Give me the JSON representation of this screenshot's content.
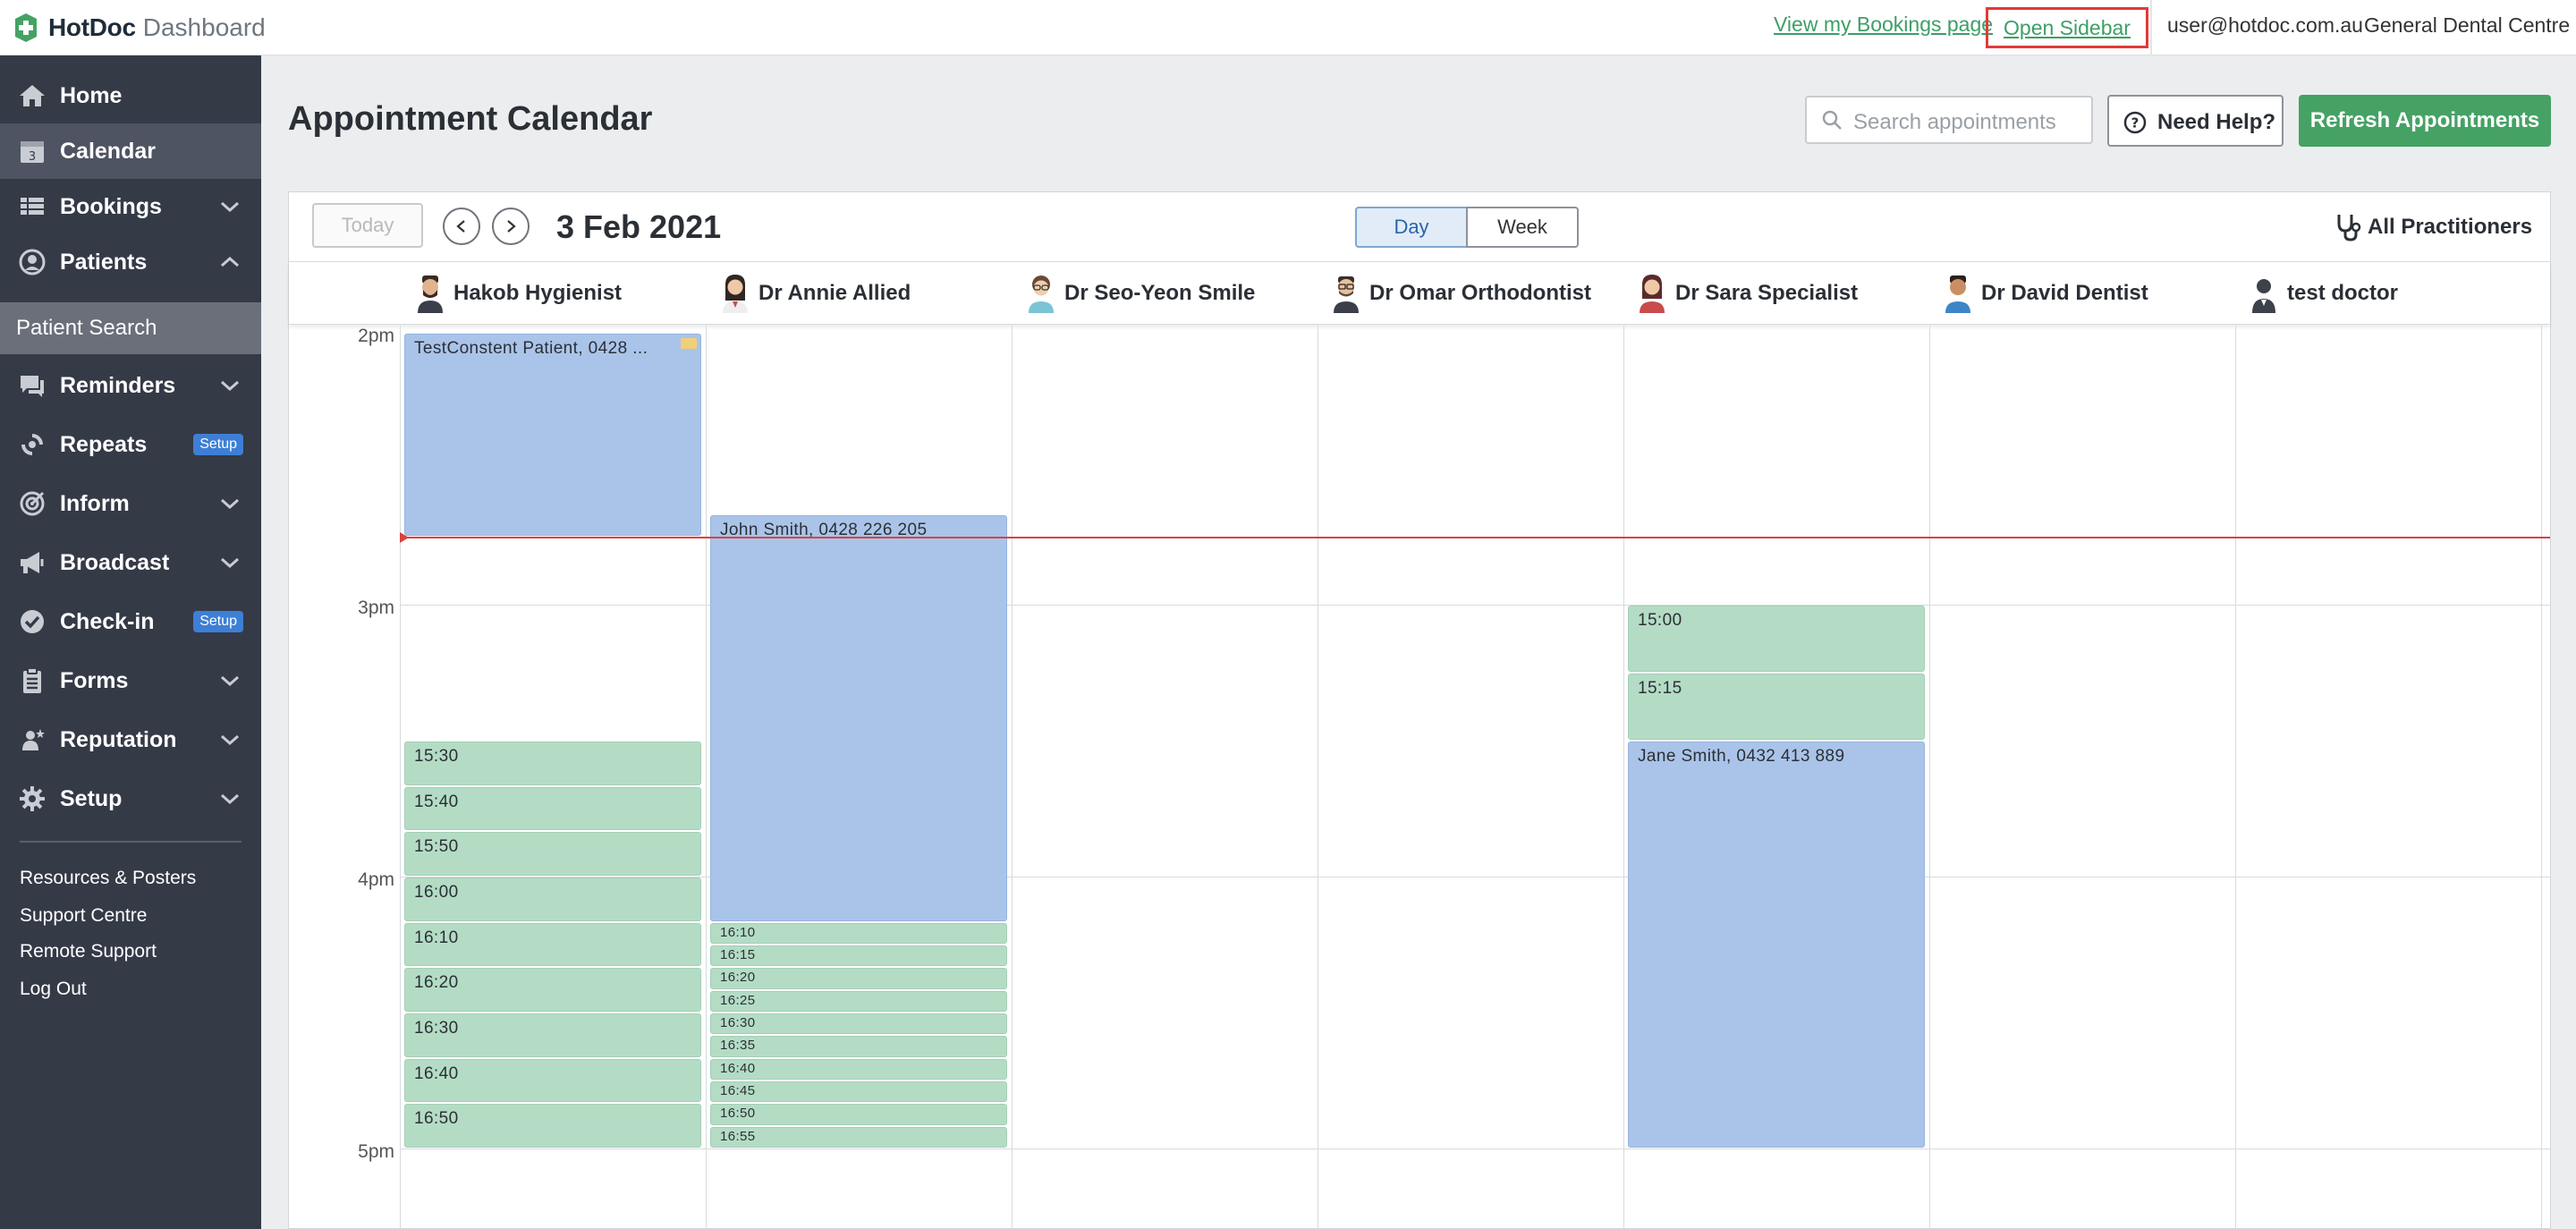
{
  "topbar": {
    "brand": "HotDoc",
    "brand_sub": "Dashboard",
    "bookings_link": "View my Bookings page",
    "open_sidebar": "Open Sidebar",
    "user_email": "user@hotdoc.com.au",
    "clinic_name": "General Dental Centre"
  },
  "sidebar": {
    "items": [
      {
        "label": "Home",
        "icon": "home-icon"
      },
      {
        "label": "Calendar",
        "icon": "calendar-icon",
        "active": true
      },
      {
        "label": "Bookings",
        "icon": "grid-icon",
        "chevron": "down"
      },
      {
        "label": "Patients",
        "icon": "user-circle-icon",
        "chevron": "up"
      },
      {
        "label": "Reminders",
        "icon": "chat-icon",
        "chevron": "down"
      },
      {
        "label": "Repeats",
        "icon": "refresh-icon",
        "badge": "Setup"
      },
      {
        "label": "Inform",
        "icon": "target-icon",
        "chevron": "down"
      },
      {
        "label": "Broadcast",
        "icon": "megaphone-icon",
        "chevron": "down"
      },
      {
        "label": "Check-in",
        "icon": "check-circle-icon",
        "badge": "Setup"
      },
      {
        "label": "Forms",
        "icon": "clipboard-icon",
        "chevron": "down"
      },
      {
        "label": "Reputation",
        "icon": "person-star-icon",
        "chevron": "down"
      },
      {
        "label": "Setup",
        "icon": "gear-icon",
        "chevron": "down"
      }
    ],
    "subitem": "Patient Search",
    "links": [
      "Resources & Posters",
      "Support Centre",
      "Remote Support",
      "Log Out"
    ]
  },
  "main": {
    "title": "Appointment Calendar",
    "search_placeholder": "Search appointments",
    "help_label": "Need Help?",
    "refresh_label": "Refresh Appointments"
  },
  "calendar": {
    "today_label": "Today",
    "date": "3 Feb 2021",
    "view_day": "Day",
    "view_week": "Week",
    "active_view": "Day",
    "all_practitioners": "All Practitioners",
    "practitioners": [
      "Hakob Hygienist",
      "Dr Annie Allied",
      "Dr Seo-Yeon Smile",
      "Dr Omar Orthodontist",
      "Dr Sara Specialist",
      "Dr David Dentist",
      "test doctor"
    ],
    "hours": [
      "2pm",
      "3pm",
      "4pm",
      "5pm"
    ],
    "appointments": [
      {
        "col": 0,
        "start": "14:00",
        "end": "14:45",
        "type": "booked",
        "label": "TestConstent Patient, 0428 ...",
        "note": true
      },
      {
        "col": 0,
        "start": "15:30",
        "end": "15:40",
        "type": "open",
        "label": "15:30"
      },
      {
        "col": 0,
        "start": "15:40",
        "end": "15:50",
        "type": "open",
        "label": "15:40"
      },
      {
        "col": 0,
        "start": "15:50",
        "end": "16:00",
        "type": "open",
        "label": "15:50"
      },
      {
        "col": 0,
        "start": "16:00",
        "end": "16:10",
        "type": "open",
        "label": "16:00"
      },
      {
        "col": 0,
        "start": "16:10",
        "end": "16:20",
        "type": "open",
        "label": "16:10"
      },
      {
        "col": 0,
        "start": "16:20",
        "end": "16:30",
        "type": "open",
        "label": "16:20"
      },
      {
        "col": 0,
        "start": "16:30",
        "end": "16:40",
        "type": "open",
        "label": "16:30"
      },
      {
        "col": 0,
        "start": "16:40",
        "end": "16:50",
        "type": "open",
        "label": "16:40"
      },
      {
        "col": 0,
        "start": "16:50",
        "end": "17:00",
        "type": "open",
        "label": "16:50"
      },
      {
        "col": 1,
        "start": "14:40",
        "end": "16:10",
        "type": "booked",
        "label": "John Smith, 0428 226 205"
      },
      {
        "col": 1,
        "start": "16:10",
        "end": "16:15",
        "type": "open",
        "label": "16:10"
      },
      {
        "col": 1,
        "start": "16:15",
        "end": "16:20",
        "type": "open",
        "label": "16:15"
      },
      {
        "col": 1,
        "start": "16:20",
        "end": "16:25",
        "type": "open",
        "label": "16:20"
      },
      {
        "col": 1,
        "start": "16:25",
        "end": "16:30",
        "type": "open",
        "label": "16:25"
      },
      {
        "col": 1,
        "start": "16:30",
        "end": "16:35",
        "type": "open",
        "label": "16:30"
      },
      {
        "col": 1,
        "start": "16:35",
        "end": "16:40",
        "type": "open",
        "label": "16:35"
      },
      {
        "col": 1,
        "start": "16:40",
        "end": "16:45",
        "type": "open",
        "label": "16:40"
      },
      {
        "col": 1,
        "start": "16:45",
        "end": "16:50",
        "type": "open",
        "label": "16:45"
      },
      {
        "col": 1,
        "start": "16:50",
        "end": "16:55",
        "type": "open",
        "label": "16:50"
      },
      {
        "col": 1,
        "start": "16:55",
        "end": "17:00",
        "type": "open",
        "label": "16:55"
      },
      {
        "col": 4,
        "start": "15:00",
        "end": "15:15",
        "type": "open",
        "label": "15:00"
      },
      {
        "col": 4,
        "start": "15:15",
        "end": "15:30",
        "type": "open",
        "label": "15:15"
      },
      {
        "col": 4,
        "start": "15:30",
        "end": "17:00",
        "type": "booked",
        "label": "Jane Smith, 0432 413 889"
      }
    ],
    "current_time": "14:45"
  },
  "colors": {
    "sidebar_bg": "#353a47",
    "accent_green": "#45a264",
    "booked": "#aac4e9",
    "open_slot": "#b4dcc5",
    "now_line": "#d9423e"
  }
}
